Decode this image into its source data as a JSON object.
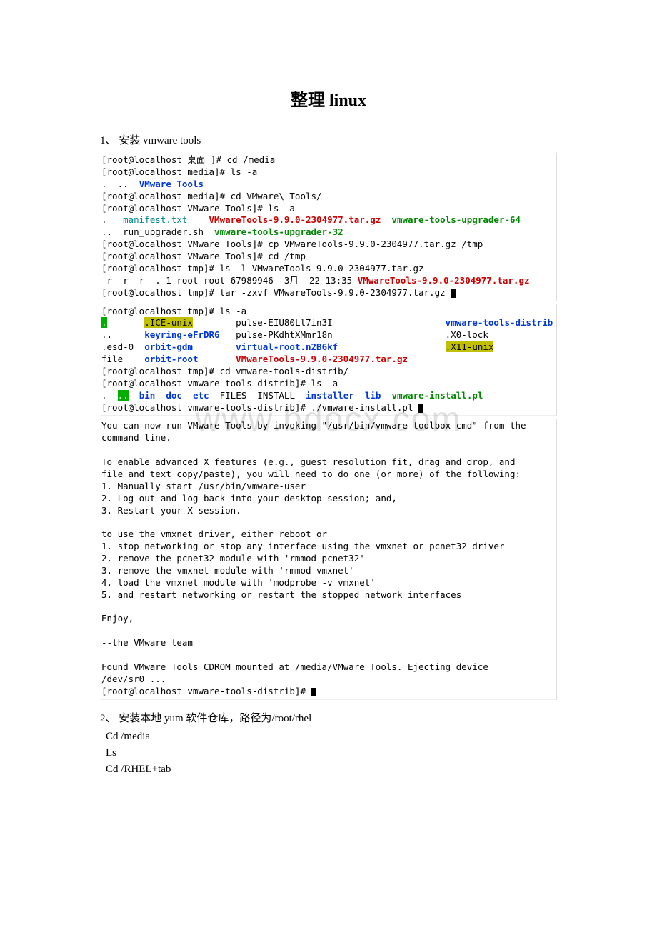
{
  "watermark": "www.bdocx.com",
  "title": "整理 linux",
  "sections": {
    "s1": "1、 安装 vmware tools",
    "s2": "2、 安装本地 yum 软件仓库，路径为/root/rhel"
  },
  "term1": {
    "l1a": "[root@localhost 桌面 ]# cd /media",
    "l2a": "[root@localhost media]# ls -a",
    "l3a": ".  ..  ",
    "l3b": "VMware Tools",
    "l4a": "[root@localhost media]# cd VMware\\ Tools/",
    "l5a": "[root@localhost VMware Tools]# ls -a",
    "l6a": ".   ",
    "l6b": "manifest.txt",
    "l6c": "    ",
    "l6d": "VMwareTools-9.9.0-2304977.tar.gz",
    "l6e": "  ",
    "l6f": "vmware-tools-upgrader-64",
    "l7a": "..  run_upgrader.sh  ",
    "l7b": "vmware-tools-upgrader-32",
    "l8a": "[root@localhost VMware Tools]# cp VMwareTools-9.9.0-2304977.tar.gz /tmp",
    "l9a": "[root@localhost VMware Tools]# cd /tmp",
    "l10a": "[root@localhost tmp]# ls -l VMwareTools-9.9.0-2304977.tar.gz",
    "l11a": "-r--r--r--. 1 root root 67989946  3月  22 13:35 ",
    "l11b": "VMwareTools-9.9.0-2304977.tar.gz",
    "l12a": "[root@localhost tmp]# tar -zxvf VMwareTools-9.9.0-2304977.tar.gz "
  },
  "term2": {
    "l1a": "[root@localhost tmp]# ls -a",
    "l2a": ".",
    "l2b": "       ",
    "l2c": ".ICE-unix",
    "l2d": "        pulse-EIU80Ll7in3I                     ",
    "l2e": "vmware-tools-distrib",
    "l3a": "..      ",
    "l3b": "keyring-eFrDR6",
    "l3c": "   pulse-PKdhtXMmr18n                     .X0-lock",
    "l4a": ".esd-0  ",
    "l4b": "orbit-gdm",
    "l4c": "        ",
    "l4d": "virtual-root.n2B6kf",
    "l4e": "                    ",
    "l4f": ".X11-unix",
    "l5a": "file    ",
    "l5b": "orbit-root",
    "l5c": "       ",
    "l5d": "VMwareTools-9.9.0-2304977.tar.gz",
    "l6a": "[root@localhost tmp]# cd vmware-tools-distrib/",
    "l7a": "[root@localhost vmware-tools-distrib]# ls -a",
    "l8a": ".  ",
    "l8b": "..",
    "l8c": "  ",
    "l8d": "bin",
    "l8e": "  ",
    "l8f": "doc",
    "l8g": "  ",
    "l8h": "etc",
    "l8i": "  FILES  INSTALL  ",
    "l8j": "installer",
    "l8k": "  ",
    "l8l": "lib",
    "l8m": "  ",
    "l8n": "vmware-install.pl",
    "l9a": "[root@localhost vmware-tools-distrib]# ./vmware-install.pl "
  },
  "term3": {
    "l1": "You can now run VMware Tools by invoking \"/usr/bin/vmware-toolbox-cmd\" from the",
    "l2": "command line.",
    "l3": "",
    "l4": "To enable advanced X features (e.g., guest resolution fit, drag and drop, and",
    "l5": "file and text copy/paste), you will need to do one (or more) of the following:",
    "l6": "1. Manually start /usr/bin/vmware-user",
    "l7": "2. Log out and log back into your desktop session; and,",
    "l8": "3. Restart your X session.",
    "l9": "",
    "l10": "to use the vmxnet driver, either reboot or",
    "l11": "1. stop networking or stop any interface using the vmxnet or pcnet32 driver",
    "l12": "2. remove the pcnet32 module with 'rmmod pcnet32'",
    "l13": "3. remove the vmxnet module with 'rmmod vmxnet'",
    "l14": "4. load the vmxnet module with 'modprobe -v vmxnet'",
    "l15": "5. and restart networking or restart the stopped network interfaces",
    "l16": "",
    "l17": "Enjoy,",
    "l18": "",
    "l19": "--the VMware team",
    "l20": "",
    "l21": "Found VMware Tools CDROM mounted at /media/VMware Tools. Ejecting device",
    "l22": "/dev/sr0 ...",
    "l23": "[root@localhost vmware-tools-distrib]# "
  },
  "body": {
    "b1": "Cd /media",
    "b2": "Ls",
    "b3": "Cd /RHEL+tab"
  }
}
